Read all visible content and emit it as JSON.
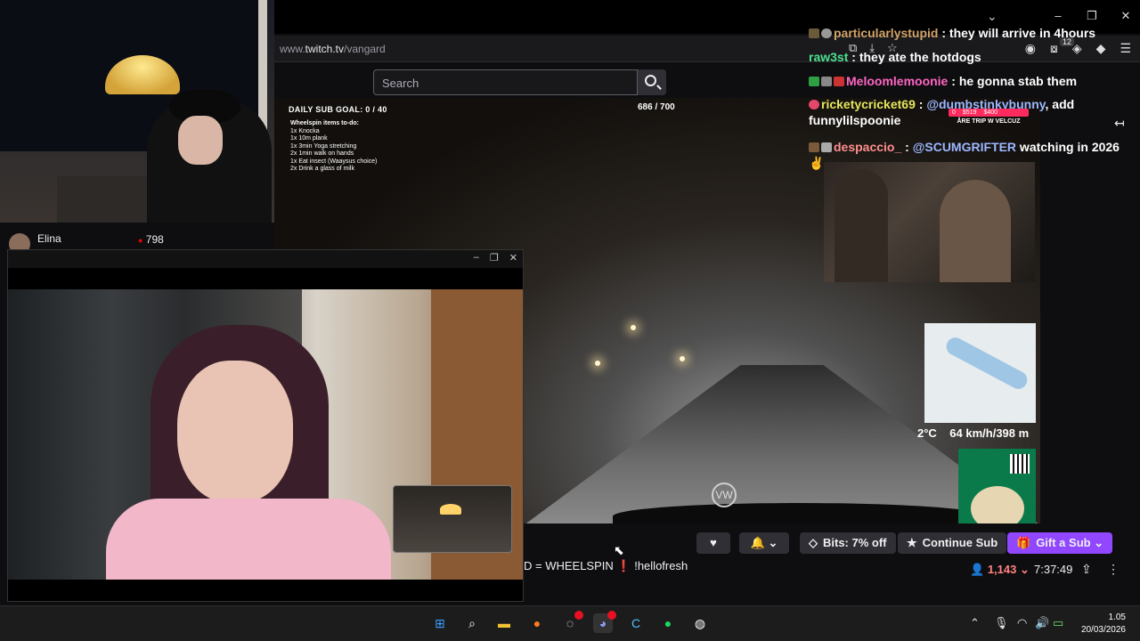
{
  "browser": {
    "url_prefix": "www.",
    "url_domain": "twitch.tv",
    "url_path": "/vangard",
    "ext_badge": "12",
    "window_controls": [
      "–",
      "❐",
      "✕"
    ]
  },
  "search": {
    "placeholder": "Search"
  },
  "overlay": {
    "sub_goal": "DAILY SUB GOAL: 0 / 40",
    "goal_count": "686 / 700",
    "wheelspin_title": "Wheelspin items to-do:",
    "wheelspin_items": [
      "1x Knocka",
      "1x 10m plank",
      "1x 3min Yoga stretching",
      "2x 1min walk on hands",
      "1x Eat insect (Waaysus choice)",
      "2x Drink a glass of milk"
    ],
    "trip_values": [
      "0",
      "$519",
      "$400"
    ],
    "trip_label": "ÅRE TRIP W VELCUZ",
    "temperature": "2°C",
    "speed": "64 km/h",
    "altitude": "398 m"
  },
  "chat": [
    {
      "user": "particularlystupid",
      "sep": " : ",
      "text": "they will arrive in 4hours"
    },
    {
      "user": "raw3st",
      "sep": " : ",
      "text": "they ate the hotdogs"
    },
    {
      "user": "Meloomlemoonie",
      "sep": " : ",
      "text": "he gonna stab them"
    },
    {
      "user": "ricketycricket69",
      "sep": " : ",
      "mention": "@dumbstinkybunny",
      "text": ", add funnylilspoonie"
    },
    {
      "user": "despaccio_",
      "sep": " : ",
      "mention": "@SCUMGRIFTER",
      "text": " watching in 2026 ✌"
    }
  ],
  "stream_bar": {
    "title_start": "D = WHEELSPIN",
    "title_bang": "❗",
    "title_cmd": "!hellofresh",
    "bits": "Bits: 7% off",
    "continue_sub": "Continue Sub",
    "gift_sub": "Gift a Sub",
    "viewers": "1,143",
    "uptime": "7:37:49"
  },
  "streamer": {
    "name": "Elina",
    "live_count": "798"
  },
  "clock": {
    "time": "1.05",
    "date": "20/03/2026"
  },
  "colors": {
    "twitch_purple": "#9147ff",
    "live_red": "#eb0400"
  }
}
